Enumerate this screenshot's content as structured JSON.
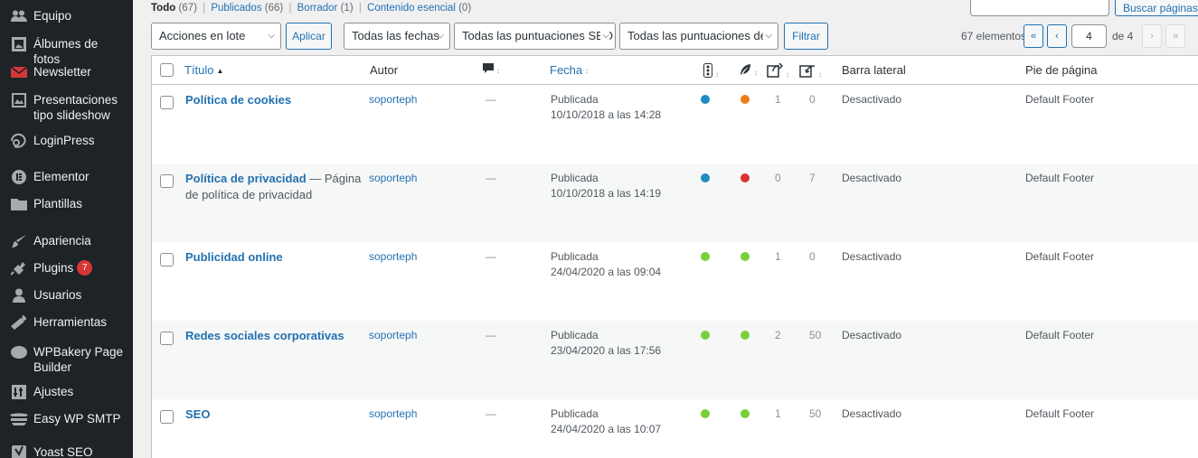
{
  "colors": {
    "green": "#7ad03a",
    "blue": "#1e8cbe",
    "orange": "#ee7c1b",
    "red": "#dc3232"
  },
  "sidebar": {
    "items": [
      {
        "label": "Equipo",
        "icon": "team-icon"
      },
      {
        "label": "Álbumes de fotos",
        "icon": "photo-albums-icon"
      },
      {
        "label": "Newsletter",
        "icon": "newsletter-icon"
      },
      {
        "label": "Presentaciones tipo slideshow",
        "icon": "slideshow-icon"
      },
      {
        "label": "LoginPress",
        "icon": "loginpress-icon"
      },
      {
        "label": "Elementor",
        "icon": "elementor-icon"
      },
      {
        "label": "Plantillas",
        "icon": "folder-icon"
      },
      {
        "label": "Apariencia",
        "icon": "brush-icon"
      },
      {
        "label": "Plugins",
        "icon": "plugin-icon",
        "badge": "7"
      },
      {
        "label": "Usuarios",
        "icon": "user-icon"
      },
      {
        "label": "Herramientas",
        "icon": "wrench-icon"
      },
      {
        "label": "WPBakery Page Builder",
        "icon": "cloud-icon"
      },
      {
        "label": "Ajustes",
        "icon": "settings-icon"
      },
      {
        "label": "Easy WP SMTP",
        "icon": "email-icon"
      },
      {
        "label": "Yoast SEO",
        "icon": "yoast-icon"
      }
    ]
  },
  "filters": {
    "all_label": "Todo",
    "all_count": "(67)",
    "published_label": "Publicados",
    "published_count": "(66)",
    "draft_label": "Borrador",
    "draft_count": "(1)",
    "cornerstone_label": "Contenido esencial",
    "cornerstone_count": "(0)"
  },
  "search": {
    "button_label": "Buscar páginas",
    "value": ""
  },
  "toolbar": {
    "bulk_actions": "Acciones en lote",
    "apply_label": "Aplicar",
    "dates": "Todas las fechas",
    "seo_scores": "Todas las puntuaciones SEO",
    "readability_scores": "Todas las puntuaciones de",
    "filter_label": "Filtrar"
  },
  "pagination": {
    "items_count": "67 elementos",
    "first": "«",
    "prev": "‹",
    "next": "›",
    "last": "»",
    "current_page": "4",
    "of_pages": "de 4"
  },
  "table": {
    "headers": {
      "title": "Título",
      "author": "Autor",
      "date": "Fecha",
      "sidebar": "Barra lateral",
      "footer": "Pie de página"
    },
    "rows": [
      {
        "title": "Política de cookies",
        "suffix": "",
        "author": "soporteph",
        "comments": "—",
        "status": "Publicada",
        "date": "10/10/2018 a las 14:28",
        "seo": "blue",
        "readability": "orange",
        "links_out": "1",
        "links_in": "0",
        "sidebar": "Desactivado",
        "footer": "Default Footer"
      },
      {
        "title": "Política de privacidad",
        "suffix": " — Página de política de privacidad",
        "author": "soporteph",
        "comments": "—",
        "status": "Publicada",
        "date": "10/10/2018 a las 14:19",
        "seo": "blue",
        "readability": "red",
        "links_out": "0",
        "links_in": "7",
        "sidebar": "Desactivado",
        "footer": "Default Footer"
      },
      {
        "title": "Publicidad online",
        "suffix": "",
        "author": "soporteph",
        "comments": "—",
        "status": "Publicada",
        "date": "24/04/2020 a las 09:04",
        "seo": "green",
        "readability": "green",
        "links_out": "1",
        "links_in": "0",
        "sidebar": "Desactivado",
        "footer": "Default Footer"
      },
      {
        "title": "Redes sociales corporativas",
        "suffix": "",
        "author": "soporteph",
        "comments": "—",
        "status": "Publicada",
        "date": "23/04/2020 a las 17:56",
        "seo": "green",
        "readability": "green",
        "links_out": "2",
        "links_in": "50",
        "sidebar": "Desactivado",
        "footer": "Default Footer"
      },
      {
        "title": "SEO",
        "suffix": "",
        "author": "soporteph",
        "comments": "—",
        "status": "Publicada",
        "date": "24/04/2020 a las 10:07",
        "seo": "green",
        "readability": "green",
        "links_out": "1",
        "links_in": "50",
        "sidebar": "Desactivado",
        "footer": "Default Footer"
      }
    ]
  }
}
